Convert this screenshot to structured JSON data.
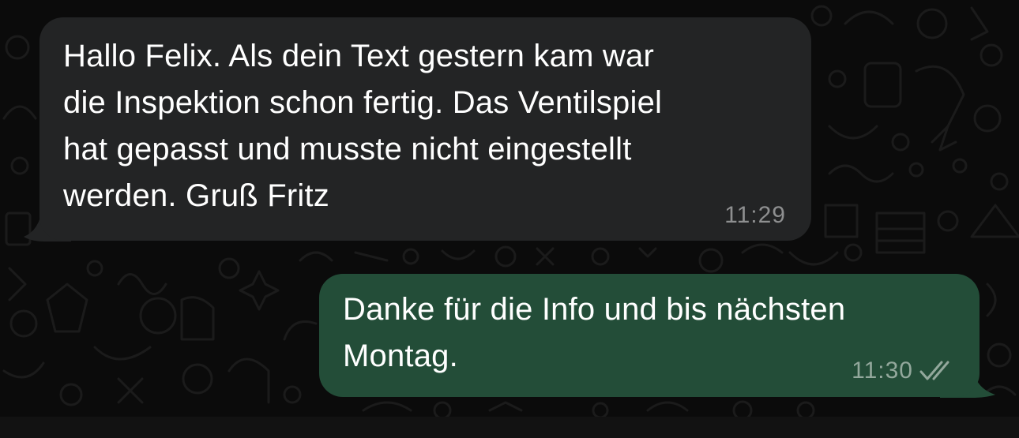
{
  "chat": {
    "messages": [
      {
        "direction": "incoming",
        "text": "Hallo Felix. Als dein Text gestern kam war\ndie Inspektion schon fertig. Das Ventilspiel\nhat gepasst und musste nicht eingestellt\nwerden. Gruß Fritz",
        "time": "11:29"
      },
      {
        "direction": "outgoing",
        "text": "Danke für die Info und bis nächsten\nMontag.",
        "time": "11:30",
        "status_icon": "double-check-icon"
      }
    ]
  },
  "colors": {
    "background": "#0b0b0b",
    "incoming_bubble": "#232425",
    "outgoing_bubble": "#234d38",
    "text": "#ffffff",
    "timestamp": "#8e8f90"
  }
}
